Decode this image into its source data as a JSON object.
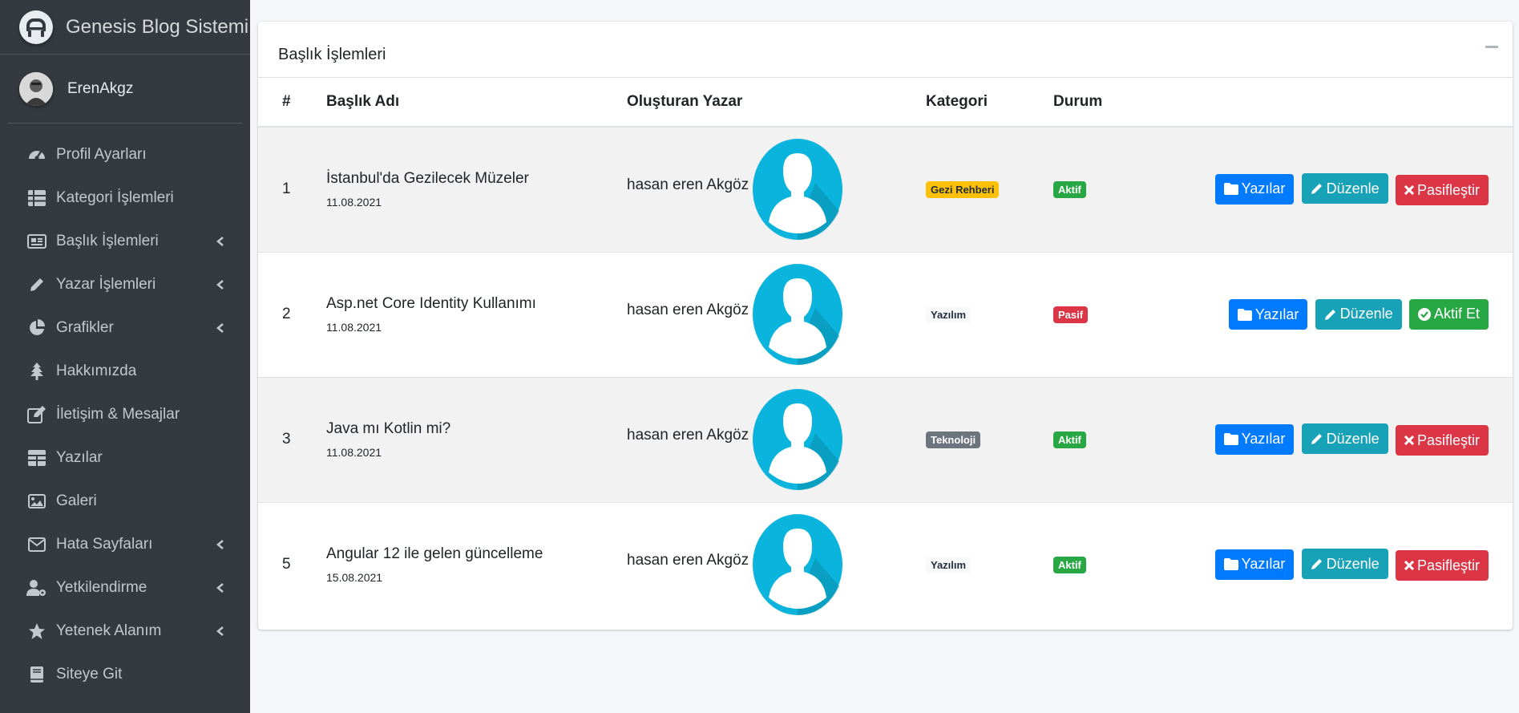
{
  "brand": {
    "title": "Genesis Blog Sistemi"
  },
  "user": {
    "name": "ErenAkgz"
  },
  "sidebar": {
    "items": [
      {
        "label": "Profil Ayarları",
        "icon": "tachometer-icon",
        "has_children": false
      },
      {
        "label": "Kategori İşlemleri",
        "icon": "table-icon",
        "has_children": false
      },
      {
        "label": "Başlık İşlemleri",
        "icon": "newspaper-icon",
        "has_children": true
      },
      {
        "label": "Yazar İşlemleri",
        "icon": "pencil-icon",
        "has_children": true
      },
      {
        "label": "Grafikler",
        "icon": "pie-chart-icon",
        "has_children": true
      },
      {
        "label": "Hakkımızda",
        "icon": "tree-icon",
        "has_children": false
      },
      {
        "label": "İletişim & Mesajlar",
        "icon": "edit-icon",
        "has_children": false
      },
      {
        "label": "Yazılar",
        "icon": "grid-icon",
        "has_children": false
      },
      {
        "label": "Galeri",
        "icon": "image-icon",
        "has_children": false
      },
      {
        "label": "Hata Sayfaları",
        "icon": "envelope-icon",
        "has_children": true
      },
      {
        "label": "Yetkilendirme",
        "icon": "user-cog-icon",
        "has_children": true
      },
      {
        "label": "Yetenek Alanım",
        "icon": "star-icon",
        "has_children": true
      },
      {
        "label": "Siteye Git",
        "icon": "book-icon",
        "has_children": false
      }
    ]
  },
  "card": {
    "title": "Başlık İşlemleri"
  },
  "table": {
    "headers": [
      "#",
      "Başlık Adı",
      "Oluşturan Yazar",
      "Kategori",
      "Durum",
      ""
    ],
    "rows": [
      {
        "num": "1",
        "title": "İstanbul'da Gezilecek Müzeler",
        "date": "11.08.2021",
        "author": "hasan eren Akgöz",
        "category": "Gezi Rehberi",
        "status": "Aktif",
        "btn_posts": "Yazılar",
        "btn_edit": "Düzenle",
        "btn_toggle": "Pasifleştir"
      },
      {
        "num": "2",
        "title": "Asp.net Core Identity Kullanımı",
        "date": "11.08.2021",
        "author": "hasan eren Akgöz",
        "category": "Yazılım",
        "status": "Pasif",
        "btn_posts": "Yazılar",
        "btn_edit": "Düzenle",
        "btn_toggle": "Aktif Et"
      },
      {
        "num": "3",
        "title": "Java mı Kotlin mi?",
        "date": "11.08.2021",
        "author": "hasan eren Akgöz",
        "category": "Teknoloji",
        "status": "Aktif",
        "btn_posts": "Yazılar",
        "btn_edit": "Düzenle",
        "btn_toggle": "Pasifleştir"
      },
      {
        "num": "5",
        "title": "Angular 12 ile gelen güncelleme",
        "date": "15.08.2021",
        "author": "hasan eren Akgöz",
        "category": "Yazılım",
        "status": "Aktif",
        "btn_posts": "Yazılar",
        "btn_edit": "Düzenle",
        "btn_toggle": "Pasifleştir"
      }
    ]
  },
  "colors": {
    "sidebar_bg": "#343a40",
    "primary": "#007bff",
    "info": "#17a2b8",
    "danger": "#dc3545",
    "success": "#28a745",
    "warning": "#ffc107",
    "secondary": "#6c757d",
    "avatar_cyan": "#0ab4dc"
  }
}
